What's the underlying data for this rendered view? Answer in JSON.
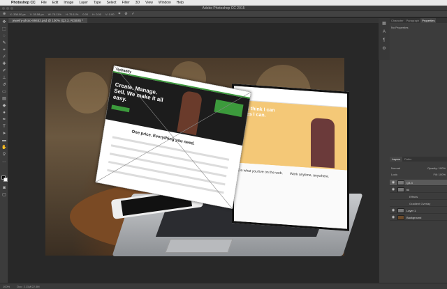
{
  "menubar": {
    "app": "Photoshop CC",
    "items": [
      "File",
      "Edit",
      "Image",
      "Layer",
      "Type",
      "Select",
      "Filter",
      "3D",
      "View",
      "Window",
      "Help"
    ]
  },
  "window_title": "Adobe Photoshop CC 2015",
  "options_bar": {
    "x": "X: 338.00 px",
    "y": "Y: 35.58 px",
    "w": "W: 75.11%",
    "h": "H: 75.11%",
    "angle": "0.00",
    "hskew": "H: 0.00",
    "vskew": "V: 0.00"
  },
  "document_tab": "jewelry-photo-89452.psd @ 100% (Q3.3, RGB/8) *",
  "properties_panel": {
    "tabs": [
      "Character",
      "Paragraph",
      "Properties"
    ],
    "active_tab": "Properties",
    "message": "No Properties"
  },
  "layers_panel": {
    "tabs": [
      "Layers",
      "Paths"
    ],
    "active_tab": "Layers",
    "blend_mode": "Normal",
    "opacity": "Opacity: 100%",
    "lock": "Lock:",
    "fill": "Fill: 100%",
    "layers": [
      {
        "name": "Q3.3",
        "selected": true,
        "sub": false
      },
      {
        "name": "fill",
        "selected": false,
        "sub": false
      },
      {
        "name": "Effects",
        "selected": false,
        "sub": true
      },
      {
        "name": "Gradient Overlay",
        "selected": false,
        "sub": true
      },
      {
        "name": "Layer 1",
        "selected": false,
        "sub": false
      },
      {
        "name": "Background",
        "selected": false,
        "sub": false
      }
    ]
  },
  "mockup": {
    "logo": "GoDaddy",
    "headline": "Create. Manage. Sell. We make it all easy.",
    "subhead": "One price. Everything you need."
  },
  "laptop_screen": {
    "headline": "Yes I think I can is Yes I can.",
    "bottom_left": "Do what you live on the web.",
    "bottom_right": "Work anytime, anywhere."
  },
  "status_bar": {
    "zoom": "100%",
    "doc": "Doc: 2.11M/22.5M"
  }
}
